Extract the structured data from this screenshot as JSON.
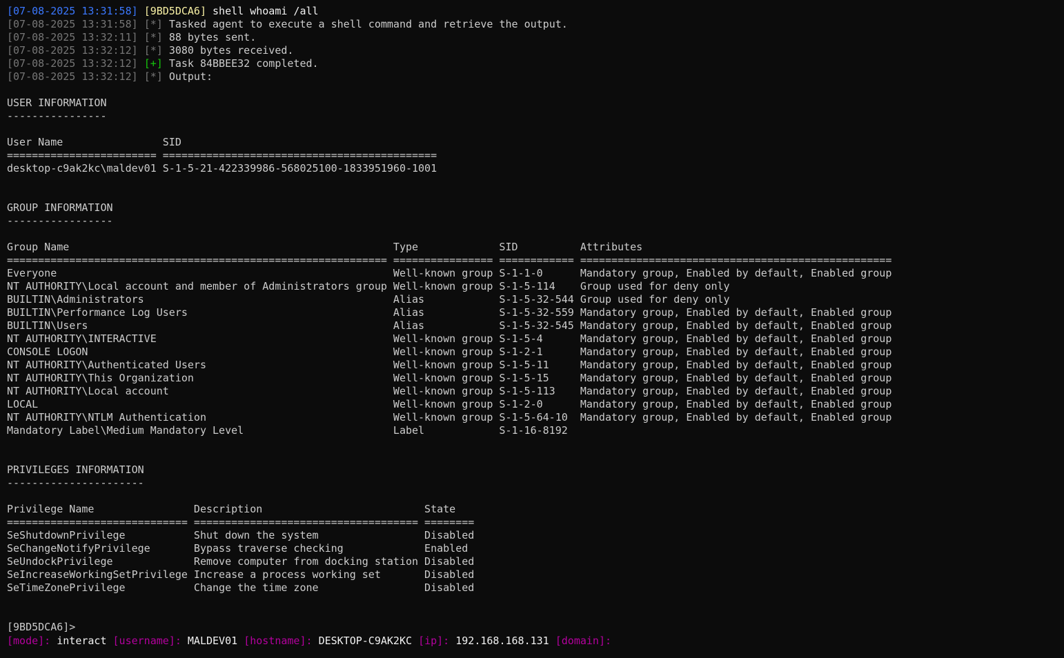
{
  "terminal": {
    "header": {
      "timestamp": "[07-08-2025 13:31:58]",
      "agent_id": "[9BD5DCA6]",
      "command": "shell whoami /all"
    },
    "log_lines": [
      {
        "timestamp": "[07-08-2025 13:31:58]",
        "marker": "[*]",
        "text": "Tasked agent to execute a shell command and retrieve the output."
      },
      {
        "timestamp": "[07-08-2025 13:32:11]",
        "marker": "[*]",
        "text": "88 bytes sent."
      },
      {
        "timestamp": "[07-08-2025 13:32:12]",
        "marker": "[*]",
        "text": "3080 bytes received."
      },
      {
        "timestamp": "[07-08-2025 13:32:12]",
        "marker": "[+]",
        "text": "Task 84BBEE32 completed."
      },
      {
        "timestamp": "[07-08-2025 13:32:12]",
        "marker": "[*]",
        "text": "Output:"
      }
    ],
    "output": [
      "",
      "USER INFORMATION",
      "----------------",
      "",
      "User Name                SID",
      "======================== ============================================",
      "desktop-c9ak2kc\\maldev01 S-1-5-21-422339986-568025100-1833951960-1001",
      "",
      "",
      "GROUP INFORMATION",
      "-----------------",
      "",
      "Group Name                                                    Type             SID          Attributes",
      "============================================================= ================ ============ ==================================================",
      "Everyone                                                      Well-known group S-1-1-0      Mandatory group, Enabled by default, Enabled group",
      "NT AUTHORITY\\Local account and member of Administrators group Well-known group S-1-5-114    Group used for deny only",
      "BUILTIN\\Administrators                                        Alias            S-1-5-32-544 Group used for deny only",
      "BUILTIN\\Performance Log Users                                 Alias            S-1-5-32-559 Mandatory group, Enabled by default, Enabled group",
      "BUILTIN\\Users                                                 Alias            S-1-5-32-545 Mandatory group, Enabled by default, Enabled group",
      "NT AUTHORITY\\INTERACTIVE                                      Well-known group S-1-5-4      Mandatory group, Enabled by default, Enabled group",
      "CONSOLE LOGON                                                 Well-known group S-1-2-1      Mandatory group, Enabled by default, Enabled group",
      "NT AUTHORITY\\Authenticated Users                              Well-known group S-1-5-11     Mandatory group, Enabled by default, Enabled group",
      "NT AUTHORITY\\This Organization                                Well-known group S-1-5-15     Mandatory group, Enabled by default, Enabled group",
      "NT AUTHORITY\\Local account                                    Well-known group S-1-5-113    Mandatory group, Enabled by default, Enabled group",
      "LOCAL                                                         Well-known group S-1-2-0      Mandatory group, Enabled by default, Enabled group",
      "NT AUTHORITY\\NTLM Authentication                              Well-known group S-1-5-64-10  Mandatory group, Enabled by default, Enabled group",
      "Mandatory Label\\Medium Mandatory Level                        Label            S-1-16-8192",
      "",
      "",
      "PRIVILEGES INFORMATION",
      "----------------------",
      "",
      "Privilege Name                Description                          State",
      "============================= ==================================== ========",
      "SeShutdownPrivilege           Shut down the system                 Disabled",
      "SeChangeNotifyPrivilege       Bypass traverse checking             Enabled",
      "SeUndockPrivilege             Remove computer from docking station Disabled",
      "SeIncreaseWorkingSetPrivilege Increase a process working set       Disabled",
      "SeTimeZonePrivilege           Change the time zone                 Disabled",
      "",
      "",
      "[9BD5DCA6]>"
    ],
    "status_bar": {
      "mode_label": "[mode]:",
      "mode_value": "interact",
      "username_label": "[username]:",
      "username_value": "MALDEV01",
      "hostname_label": "[hostname]:",
      "hostname_value": "DESKTOP-C9AK2KC",
      "ip_label": "[ip]:",
      "ip_value": "192.168.168.131",
      "domain_label": "[domain]:",
      "domain_value": ""
    },
    "colors": {
      "background": "#0c0c0c",
      "text": "#cccccc",
      "timestamp_header": "#3b78ff",
      "agent_id": "#f9f1a5",
      "log_gray": "#767676",
      "success_marker": "#16c60c",
      "status_label": "#b4009e"
    }
  }
}
